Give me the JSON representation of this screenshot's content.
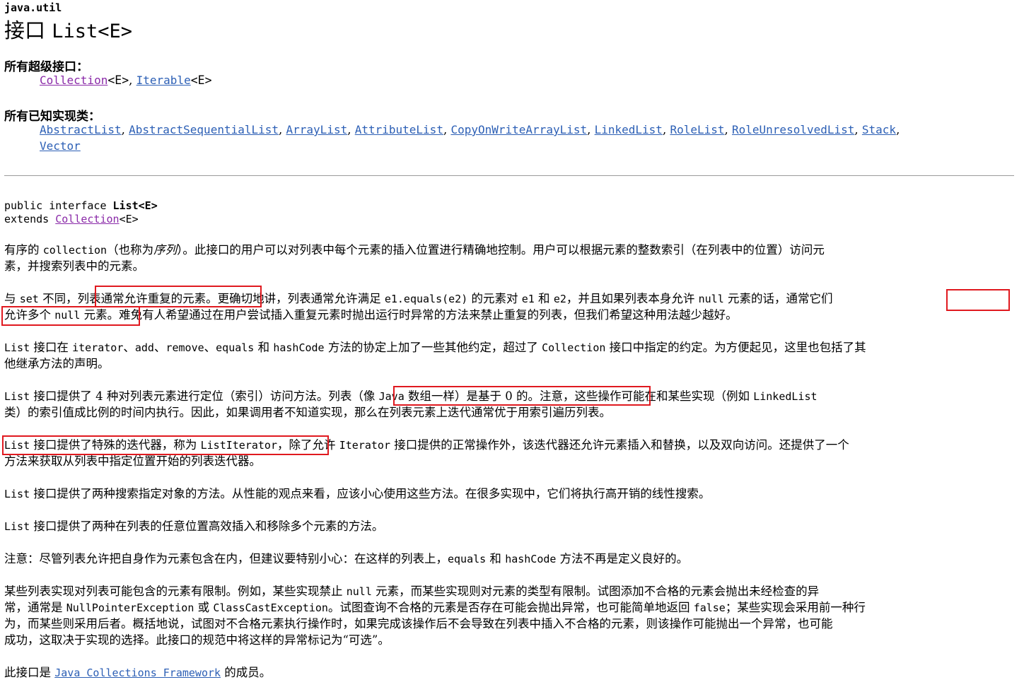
{
  "header": {
    "package": "java.util",
    "title_prefix": "接口 ",
    "title_name": "List<E>"
  },
  "superinterfaces": {
    "heading": "所有超级接口：",
    "items": [
      "Collection",
      "Iterable"
    ],
    "suffix": "<E>",
    "sep": ", "
  },
  "implementations": {
    "heading": "所有已知实现类：",
    "items": [
      "AbstractList",
      "AbstractSequentialList",
      "ArrayList",
      "AttributeList",
      "CopyOnWriteArrayList",
      "LinkedList",
      "RoleList",
      "RoleUnresolvedList",
      "Stack",
      "Vector"
    ]
  },
  "signature": {
    "line1_prefix": "public interface ",
    "line1_name": "List<E>",
    "line2_prefix": "extends ",
    "line2_link": "Collection",
    "line2_suffix": "<E>"
  },
  "description": {
    "p1": {
      "a1": "有序的 ",
      "a2": "collection",
      "a3": "（也称为",
      "a4": "序列",
      "a5": "）。此接口的用户可以对列表中每个元素的插入位置进行精确地控制。用户可以根据元素的整数索引（在列表中的位置）访问元",
      "b1": "素，并搜索列表中的元素。"
    },
    "p2": {
      "a1": "与 ",
      "a2": "set",
      "a3": " 不同，",
      "a4": "列表通常允许重复的元素。",
      "a5": "更确切地讲，列表通常允许满足 ",
      "a6": "e1.equals(e2)",
      "a7": " 的元素对 ",
      "a8": "e1",
      "a9": " 和 ",
      "a10": "e2",
      "a11": "，并且如果列表本身允许 ",
      "a12": "null",
      "a13": " 元素的话，",
      "a14": "通常它们",
      "b1": "允许多个 ",
      "b2": "null",
      "b3": " 元素。",
      "b4": "难免有人希望通过在用户尝试插入重复元素时抛出运行时异常的方法来禁止重复的列表，但我们希望这种用法越少越好。"
    },
    "p3": {
      "a1": "List",
      "a2": " 接口在 ",
      "a3": "iterator",
      "a4": "、",
      "a5": "add",
      "a6": "、",
      "a7": "remove",
      "a8": "、",
      "a9": "equals",
      "a10": " 和 ",
      "a11": "hashCode",
      "a12": " 方法的协定上加了一些其他约定，超过了 ",
      "a13": "Collection",
      "a14": " 接口中指定的约定。为方便起见，这里也包括了其",
      "b1": "他继承方法的声明。"
    },
    "p4": {
      "a1": "List",
      "a2": " 接口提供了 4 种对列表元素进行定位（索引）访问方法。",
      "a3": "列表（像 ",
      "a4": "Java",
      "a5": " 数组一样）是基于 0 的。",
      "a6": "注意，这些操作可能在和某些实现（例如 ",
      "a7": "LinkedList",
      "b1": "类）的索引值成比例的时间内执行。因此，如果调用者不知道实现，那么在列表元素上迭代通常优于用索引遍历列表。"
    },
    "p5": {
      "a1": "List",
      "a2": " 接口提供了特殊的迭代器，称为 ",
      "a3": "ListIterator",
      "a4": "，",
      "a5": "除了允许 ",
      "a6": "Iterator",
      "a7": " 接口提供的正常操作外，该迭代器还允许元素插入和替换，以及双向访问。还提供了一个",
      "b1": "方法来获取从列表中指定位置开始的列表迭代器。"
    },
    "p6": {
      "a1": "List",
      "a2": " 接口提供了两种搜索指定对象的方法。从性能的观点来看，应该小心使用这些方法。在很多实现中，它们将执行高开销的线性搜索。"
    },
    "p7": {
      "a1": "List",
      "a2": " 接口提供了两种在列表的任意位置高效插入和移除多个元素的方法。"
    },
    "p8": {
      "a1": "注意：尽管列表允许把自身作为元素包含在内，但建议要特别小心：在这样的列表上，",
      "a2": "equals",
      "a3": " 和 ",
      "a4": "hashCode",
      "a5": " 方法不再是定义良好的。"
    },
    "p9": {
      "a1": "某些列表实现对列表可能包含的元素有限制。例如，某些实现禁止 ",
      "a2": "null",
      "a3": " 元素，而某些实现则对元素的类型有限制。试图添加不合格的元素会抛出未经检查的异",
      "b1": "常，通常是 ",
      "b2": "NullPointerException",
      "b3": " 或 ",
      "b4": "ClassCastException",
      "b5": "。试图查询不合格的元素是否存在可能会抛出异常，也可能简单地返回 ",
      "b6": "false",
      "b7": "；某些实现会采用前一种行",
      "c1": "为，而某些则采用后者。概括地说，试图对不合格元素执行操作时，如果完成该操作后不会导致在列表中插入不合格的元素，则该操作可能抛出一个异常，也可能",
      "d1": "成功，这取决于实现的选择。此接口的规范中将这样的异常标记为“可选”。"
    },
    "p10": {
      "a1": "此接口是 ",
      "a2": "Java Collections Framework",
      "a3": " 的成员。"
    }
  }
}
